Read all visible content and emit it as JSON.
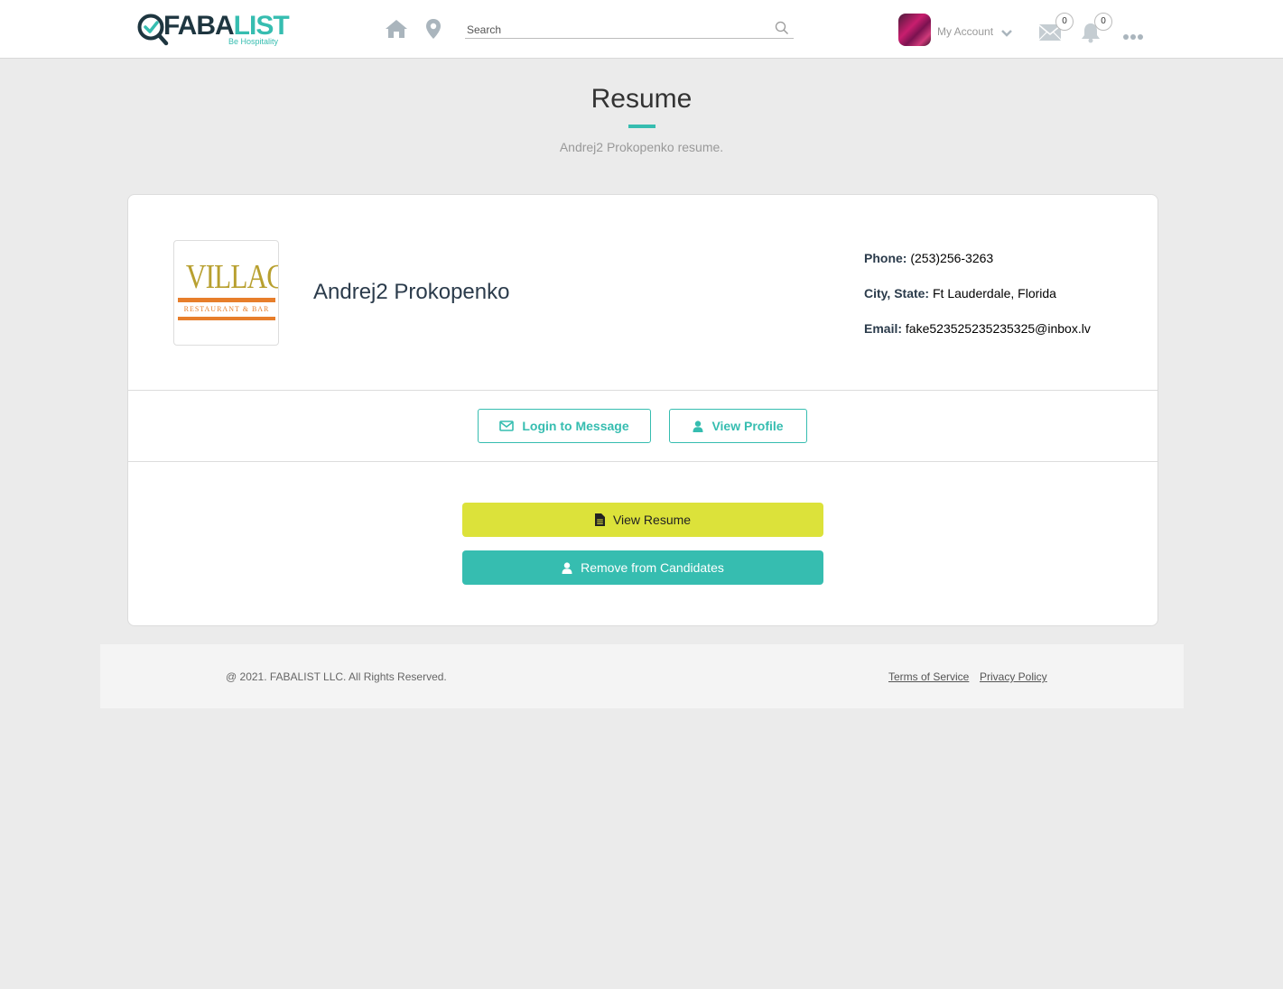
{
  "header": {
    "logo": {
      "brand_dark": "FABA",
      "brand_accent": "LIST",
      "tagline": "Be Hospitality"
    },
    "search": {
      "placeholder": "Search",
      "value": ""
    },
    "account_label": "My Account",
    "messages_count": "0",
    "notifications_count": "0",
    "icons": [
      "home-icon",
      "map-pin-icon",
      "search-icon",
      "chevron-down-icon",
      "envelope-icon",
      "bell-icon",
      "more-icon"
    ]
  },
  "page": {
    "title": "Resume",
    "subtitle": "Andrej2 Prokopenko resume."
  },
  "candidate": {
    "name": "Andrej2 Prokopenko",
    "company_logo": {
      "name": "VILLAGIO",
      "subtitle": "RESTAURANT & BAR"
    },
    "phone_label": "Phone:",
    "phone": "(253)256-3263",
    "city_label": "City, State:",
    "city": "Ft Lauderdale, Florida",
    "email_label": "Email:",
    "email": "fake523525235235325@inbox.lv"
  },
  "actions": {
    "login_message": "Login to Message",
    "view_profile": "View Profile",
    "view_resume": "View Resume",
    "remove_candidate": "Remove from Candidates"
  },
  "footer": {
    "copyright": "@ 2021. FABALIST LLC. All Rights Reserved.",
    "terms": "Terms of Service",
    "privacy": "Privacy Policy"
  },
  "colors": {
    "accent": "#36bdb0",
    "yellow_button": "#dce23a",
    "logo_dark": "#1e3640",
    "background": "#ebebeb"
  }
}
